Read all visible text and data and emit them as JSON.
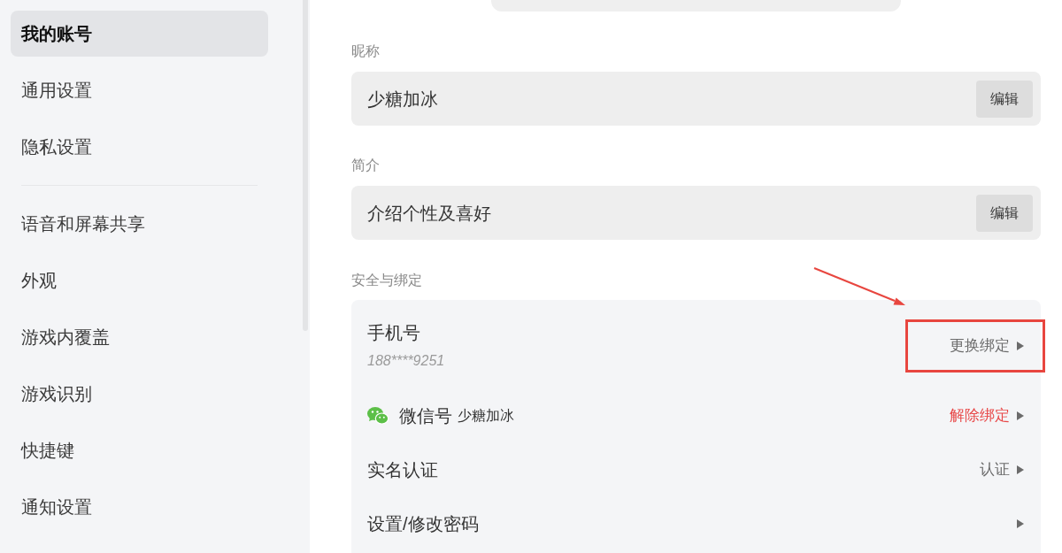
{
  "sidebar": {
    "groups": [
      {
        "items": [
          {
            "label": "我的账号",
            "selected": true
          },
          {
            "label": "通用设置",
            "selected": false
          },
          {
            "label": "隐私设置",
            "selected": false
          }
        ]
      },
      {
        "items": [
          {
            "label": "语音和屏幕共享",
            "selected": false
          },
          {
            "label": "外观",
            "selected": false
          },
          {
            "label": "游戏内覆盖",
            "selected": false
          },
          {
            "label": "游戏识别",
            "selected": false
          },
          {
            "label": "快捷键",
            "selected": false
          },
          {
            "label": "通知设置",
            "selected": false
          }
        ]
      }
    ]
  },
  "profile_fields": [
    {
      "label": "昵称",
      "value": "少糖加冰",
      "button": "编辑"
    },
    {
      "label": "简介",
      "value": "介绍个性及喜好",
      "button": "编辑"
    }
  ],
  "security": {
    "label": "安全与绑定",
    "items": [
      {
        "kind": "phone",
        "title": "手机号",
        "value": "188****9251",
        "action": {
          "label": "更换绑定",
          "danger": false
        },
        "highlighted": true
      },
      {
        "kind": "wechat",
        "title": "微信号",
        "value": "少糖加冰",
        "action": {
          "label": "解除绑定",
          "danger": true
        },
        "highlighted": false
      },
      {
        "kind": "plain",
        "title": "实名认证",
        "action": {
          "label": "认证",
          "danger": false
        },
        "highlighted": false
      },
      {
        "kind": "plain",
        "title": "设置/修改密码",
        "highlighted": false
      }
    ]
  }
}
